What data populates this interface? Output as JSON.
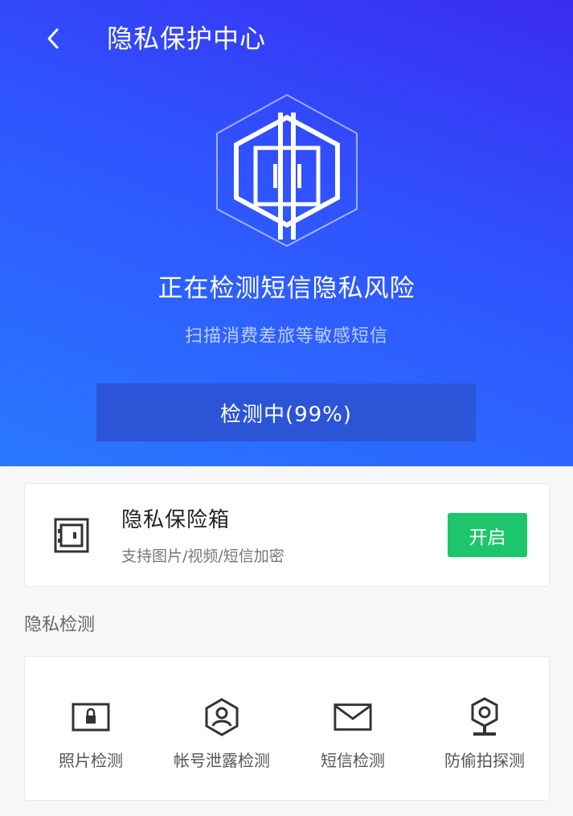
{
  "header": {
    "title": "隐私保护中心",
    "back_icon": "chevron-left-icon"
  },
  "scan": {
    "title": "正在检测短信隐私风险",
    "subtitle": "扫描消费差旅等敏感短信",
    "progress_label": "检测中(99%)",
    "progress_percent": 99,
    "shield_icon": "shield-hexagon-icon"
  },
  "vault": {
    "icon": "safe-box-icon",
    "title": "隐私保险箱",
    "desc": "支持图片/视频/短信加密",
    "button_label": "开启",
    "button_color": "#1ec66b"
  },
  "detection": {
    "section_title": "隐私检测",
    "items": [
      {
        "label": "照片检测",
        "icon": "photo-lock-icon"
      },
      {
        "label": "帐号泄露检测",
        "icon": "account-shield-icon"
      },
      {
        "label": "短信检测",
        "icon": "envelope-icon"
      },
      {
        "label": "防偷拍探测",
        "icon": "camera-detect-icon"
      }
    ]
  },
  "colors": {
    "hero_start": "#3a2cf0",
    "hero_end": "#2a78ff",
    "accent_green": "#1ec66b"
  }
}
